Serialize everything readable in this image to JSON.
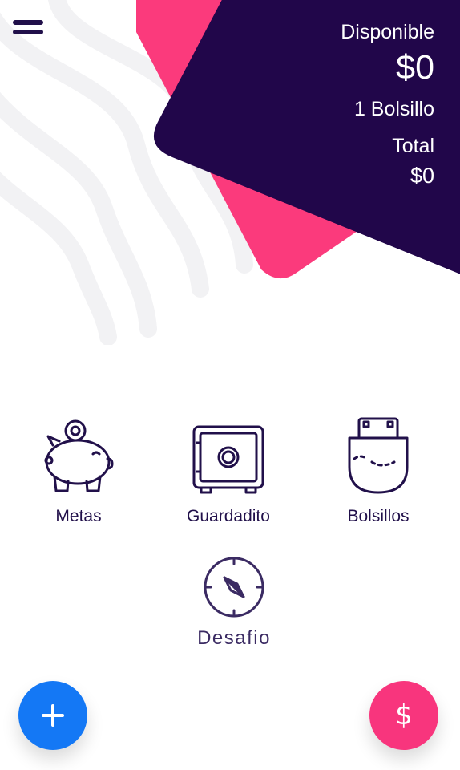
{
  "header": {
    "menu_icon": "hamburger-icon",
    "balance": {
      "available_label": "Disponible",
      "available_amount": "$0",
      "pockets_count": "1 Bolsillo",
      "total_label": "Total",
      "total_amount": "$0"
    }
  },
  "colors": {
    "card_dark": "#21064a",
    "card_pink": "#fb3a7c",
    "text_dark": "#21104a",
    "fab_add": "#1478f5",
    "fab_money": "#f8357d"
  },
  "features": [
    {
      "label": "Metas",
      "icon": "piggy-bank-icon"
    },
    {
      "label": "Guardadito",
      "icon": "safe-icon"
    },
    {
      "label": "Bolsillos",
      "icon": "pocket-icon"
    },
    {
      "label": "Desafio",
      "icon": "compass-icon"
    }
  ],
  "fabs": {
    "add_icon": "plus-icon",
    "money_icon": "dollar-icon",
    "money_symbol": "$"
  }
}
